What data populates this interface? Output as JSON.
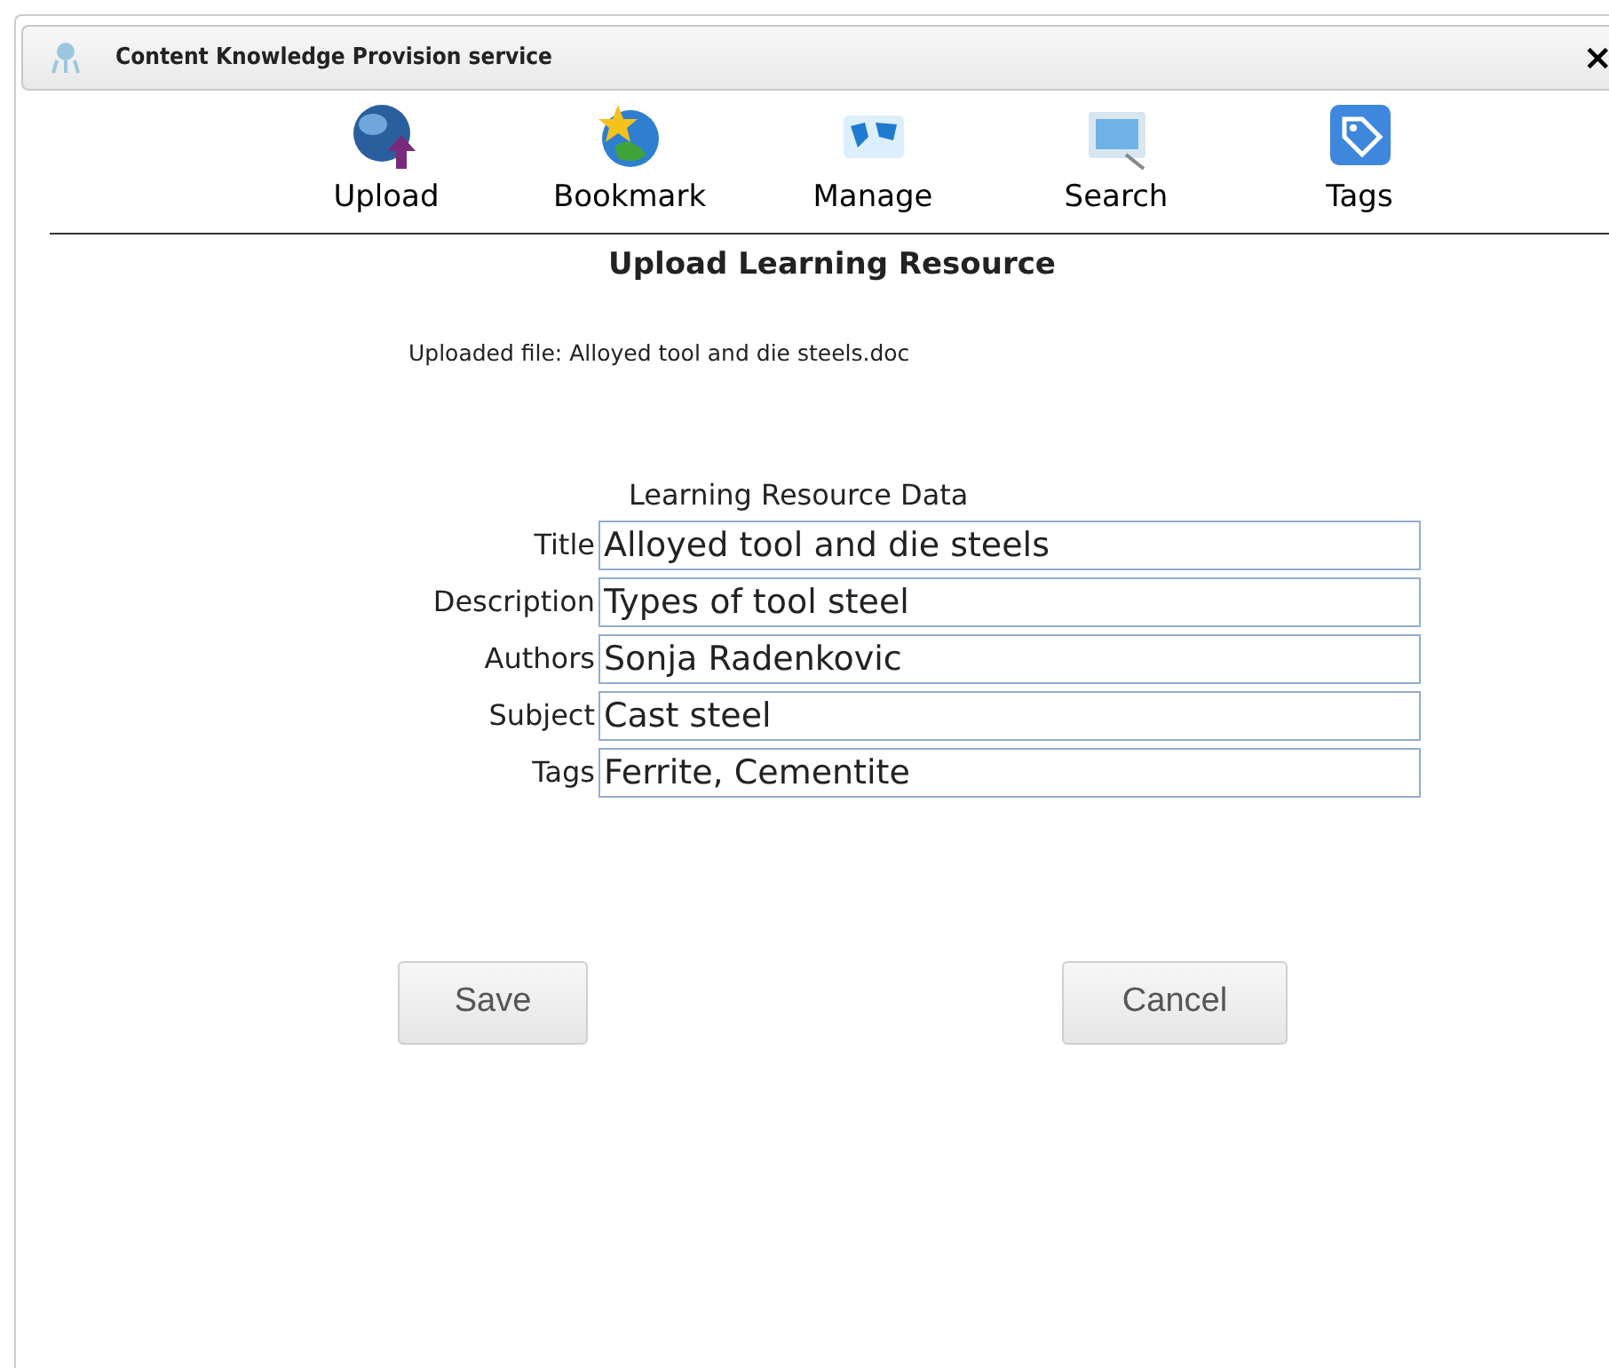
{
  "window": {
    "title": "Content Knowledge Provision service",
    "close": "×"
  },
  "toolbar": [
    {
      "label": "Upload"
    },
    {
      "label": "Bookmark"
    },
    {
      "label": "Manage"
    },
    {
      "label": "Search"
    },
    {
      "label": "Tags"
    }
  ],
  "heading": "Upload Learning Resource",
  "uploaded_file": "Uploaded file: Alloyed tool and die steels.doc",
  "form": {
    "title": "Learning Resource Data",
    "fields": [
      {
        "label": "Title",
        "value": "Alloyed tool and die steels"
      },
      {
        "label": "Description",
        "value": "Types of tool steel"
      },
      {
        "label": "Authors",
        "value": "Sonja Radenkovic"
      },
      {
        "label": "Subject",
        "value": "Cast steel"
      },
      {
        "label": "Tags",
        "value": "Ferrite, Cementite"
      }
    ]
  },
  "buttons": [
    "Save",
    "Cancel"
  ]
}
